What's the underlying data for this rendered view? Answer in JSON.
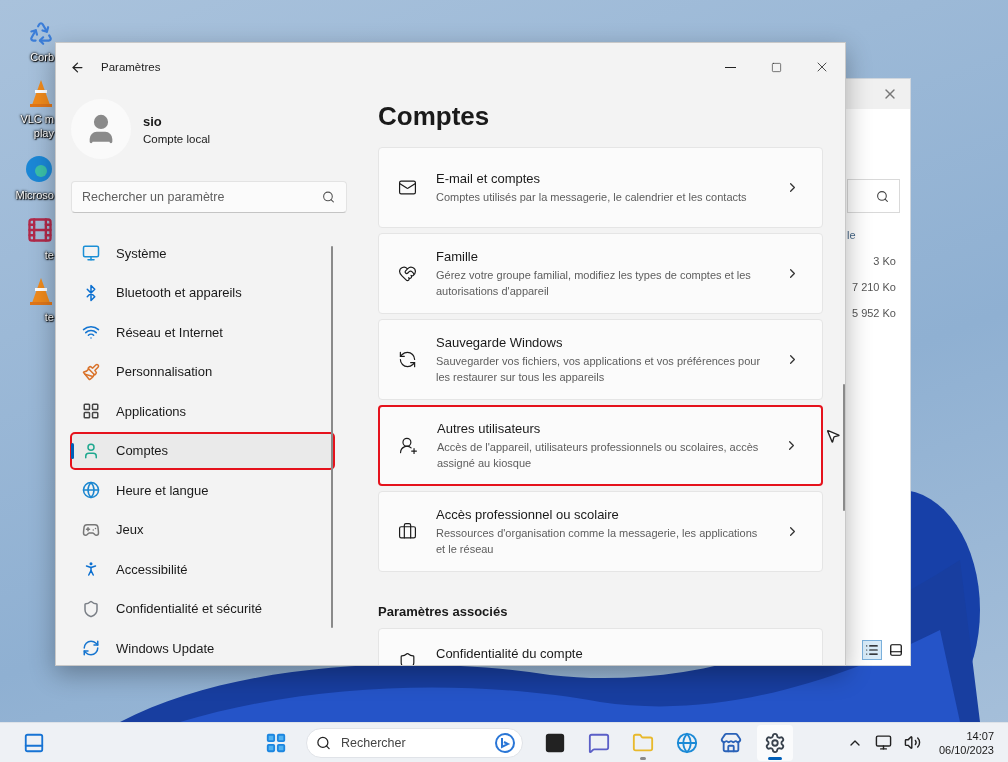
{
  "desktop": {
    "icons": [
      {
        "label": "Corb"
      },
      {
        "label": "VLC m play"
      },
      {
        "label": "Microso"
      },
      {
        "label": "te"
      },
      {
        "label": "te"
      }
    ]
  },
  "explorer": {
    "column_header": "le",
    "sizes": [
      "3 Ko",
      "7 210 Ko",
      "5 952 Ko"
    ]
  },
  "settings": {
    "window": {
      "title": "Paramètres"
    },
    "profile": {
      "name": "sio",
      "account_type": "Compte local"
    },
    "search": {
      "placeholder": "Rechercher un paramètre"
    },
    "nav": [
      {
        "label": "Système",
        "selected": false,
        "highlighted": false
      },
      {
        "label": "Bluetooth et appareils",
        "selected": false,
        "highlighted": false
      },
      {
        "label": "Réseau et Internet",
        "selected": false,
        "highlighted": false
      },
      {
        "label": "Personnalisation",
        "selected": false,
        "highlighted": false
      },
      {
        "label": "Applications",
        "selected": false,
        "highlighted": false
      },
      {
        "label": "Comptes",
        "selected": true,
        "highlighted": true
      },
      {
        "label": "Heure et langue",
        "selected": false,
        "highlighted": false
      },
      {
        "label": "Jeux",
        "selected": false,
        "highlighted": false
      },
      {
        "label": "Accessibilité",
        "selected": false,
        "highlighted": false
      },
      {
        "label": "Confidentialité et sécurité",
        "selected": false,
        "highlighted": false
      },
      {
        "label": "Windows Update",
        "selected": false,
        "highlighted": false
      }
    ],
    "heading": "Comptes",
    "cards": [
      {
        "title": "E-mail et comptes",
        "description": "Comptes utilisés par la messagerie, le calendrier et les contacts",
        "highlighted": false
      },
      {
        "title": "Famille",
        "description": "Gérez votre groupe familial, modifiez les types de comptes et les autorisations d'appareil",
        "highlighted": false
      },
      {
        "title": "Sauvegarde Windows",
        "description": "Sauvegarder vos fichiers, vos applications et vos préférences pour les restaurer sur tous les appareils",
        "highlighted": false
      },
      {
        "title": "Autres utilisateurs",
        "description": "Accès de l'appareil, utilisateurs professionnels ou scolaires, accès assigné au kiosque",
        "highlighted": true
      },
      {
        "title": "Accès professionnel ou scolaire",
        "description": "Ressources d'organisation comme la messagerie, les applications et le réseau",
        "highlighted": false
      }
    ],
    "related_heading": "Paramètres associés",
    "related_cards": [
      {
        "title": "Confidentialité du compte"
      }
    ]
  },
  "taskbar": {
    "search": {
      "placeholder": "Rechercher"
    },
    "apps": [
      {
        "running": false,
        "active": false
      },
      {
        "running": false,
        "active": false
      },
      {
        "running": true,
        "active": false
      },
      {
        "running": false,
        "active": false
      },
      {
        "running": false,
        "active": false
      },
      {
        "running": true,
        "active": true
      }
    ],
    "time": "14:07",
    "date": "06/10/2023"
  }
}
